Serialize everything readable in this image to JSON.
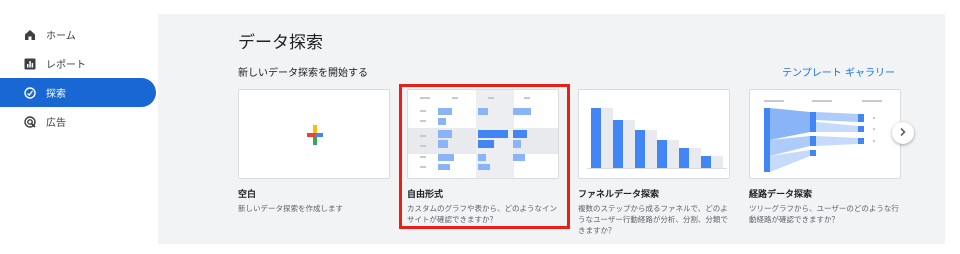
{
  "sidebar": {
    "items": [
      {
        "label": "ホーム",
        "icon": "home-icon"
      },
      {
        "label": "レポート",
        "icon": "bar-chart-icon"
      },
      {
        "label": "探索",
        "icon": "explore-icon",
        "active": true
      },
      {
        "label": "広告",
        "icon": "ads-icon"
      }
    ]
  },
  "main": {
    "title": "データ探索",
    "section_label": "新しいデータ探索を開始する",
    "gallery_link": "テンプレート ギャラリー",
    "cards": [
      {
        "title": "空白",
        "desc": "新しいデータ探索を作成します"
      },
      {
        "title": "自由形式",
        "desc": "カスタムのグラフや表から、どのようなインサイトが確認できますか？"
      },
      {
        "title": "ファネルデータ探索",
        "desc": "複数のステップから成るファネルで、どのようなユーザー行動経路が分析、分割、分類できますか？"
      },
      {
        "title": "経路データ探索",
        "desc": "ツリーグラフから、ユーザーのどのような行動経路が確認できますか？"
      }
    ]
  },
  "colors": {
    "accent": "#1967d2",
    "link": "#1a73e8",
    "highlight": "#e8201a",
    "bar": "#8ab4f8",
    "bar_dark": "#4285f4"
  }
}
